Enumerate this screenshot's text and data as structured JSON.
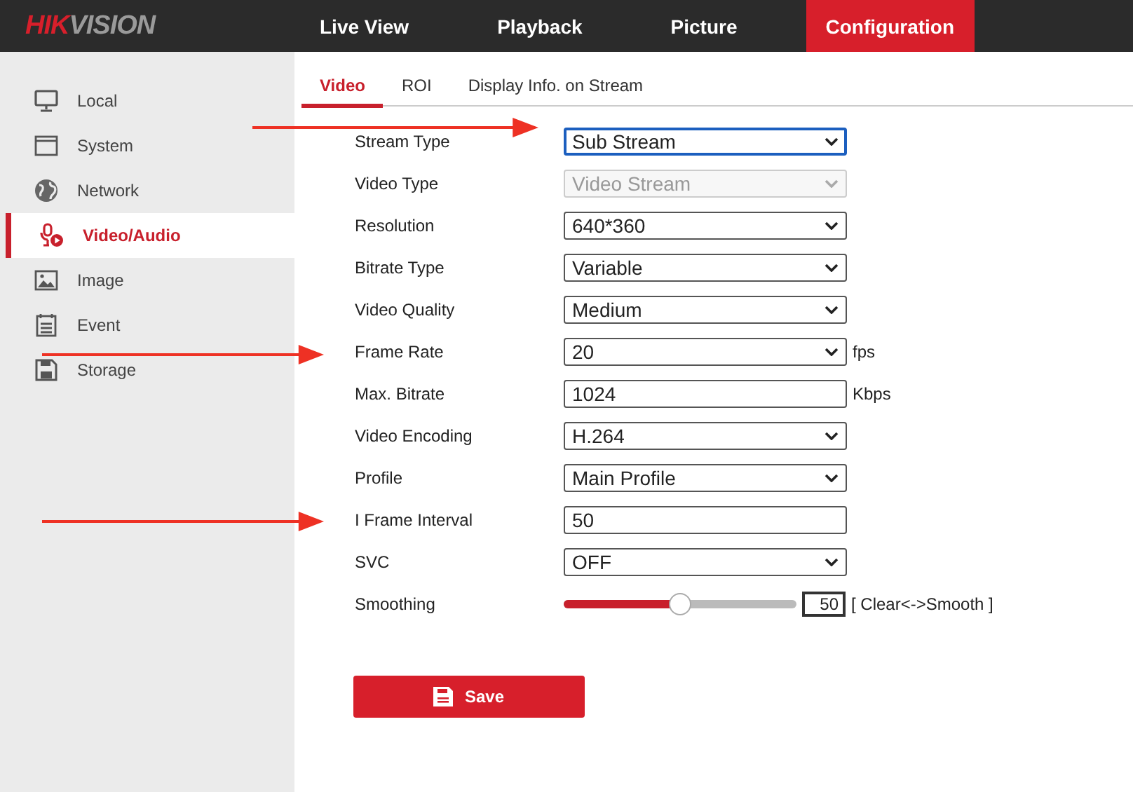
{
  "logo": [
    {
      "text": "HIK",
      "color": "#d71f2b"
    },
    {
      "text": "VISION",
      "color": "#9a9a9a"
    }
  ],
  "nav": [
    {
      "label": "Live View",
      "selected": false
    },
    {
      "label": "Playback",
      "selected": false
    },
    {
      "label": "Picture",
      "selected": false
    },
    {
      "label": "Configuration",
      "selected": true
    }
  ],
  "sidebar": {
    "items": [
      {
        "label": "Local",
        "selected": false
      },
      {
        "label": "System",
        "selected": false
      },
      {
        "label": "Network",
        "selected": false
      },
      {
        "label": "Video/Audio",
        "selected": true
      },
      {
        "label": "Image",
        "selected": false
      },
      {
        "label": "Event",
        "selected": false
      },
      {
        "label": "Storage",
        "selected": false
      }
    ]
  },
  "tabs": [
    {
      "label": "Video",
      "selected": true
    },
    {
      "label": "ROI",
      "selected": false
    },
    {
      "label": "Display Info. on Stream",
      "selected": false
    }
  ],
  "form": [
    {
      "kind": "select",
      "label": "Stream Type",
      "value": "Sub Stream",
      "focused": true
    },
    {
      "kind": "select",
      "label": "Video Type",
      "value": "Video Stream",
      "disabled": true
    },
    {
      "kind": "select",
      "label": "Resolution",
      "value": "640*360"
    },
    {
      "kind": "select",
      "label": "Bitrate Type",
      "value": "Variable"
    },
    {
      "kind": "select",
      "label": "Video Quality",
      "value": "Medium"
    },
    {
      "kind": "select",
      "label": "Frame Rate",
      "value": "20",
      "unit": "fps"
    },
    {
      "kind": "input",
      "label": "Max. Bitrate",
      "value": "1024",
      "unit": "Kbps"
    },
    {
      "kind": "select",
      "label": "Video Encoding",
      "value": "H.264"
    },
    {
      "kind": "select",
      "label": "Profile",
      "value": "Main Profile"
    },
    {
      "kind": "input",
      "label": "I Frame Interval",
      "value": "50"
    },
    {
      "kind": "select",
      "label": "SVC",
      "value": "OFF"
    },
    {
      "kind": "slider",
      "label": "Smoothing",
      "level": 0.5,
      "value": "50",
      "unit": "[ Clear<->Smooth ]"
    }
  ],
  "save_button": {
    "label": "Save"
  },
  "annotations": [
    {
      "kind": "arrow"
    },
    {
      "kind": "arrow"
    },
    {
      "kind": "arrow"
    }
  ]
}
